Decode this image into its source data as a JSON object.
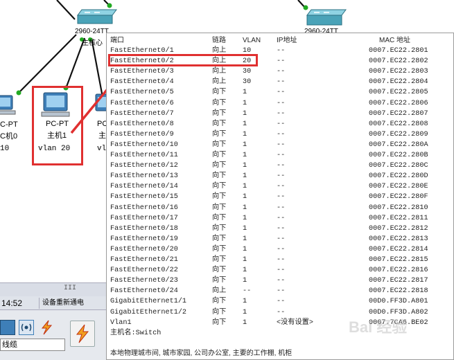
{
  "switch_labels": {
    "left_model": "2960-24TT",
    "left_name": "主核心",
    "right_model": "2960-24TT"
  },
  "pcs": [
    {
      "type": "PC-PT",
      "name": "C机0",
      "vlan": "10",
      "type_cut": "C-PT"
    },
    {
      "type": "PC-PT",
      "name": "主机1",
      "vlan": "vlan 20"
    },
    {
      "type": "PC",
      "name": "主",
      "vlan": "vl"
    }
  ],
  "popup": {
    "headers": {
      "port": "端口",
      "link": "链路",
      "vlan": "VLAN",
      "ip": "IP地址",
      "mac": "MAC 地址"
    },
    "rows": [
      {
        "port": "FastEthernet0/1",
        "link": "向上",
        "vlan": "10",
        "ip": "--",
        "mac": "0007.EC22.2801"
      },
      {
        "port": "FastEthernet0/2",
        "link": "向上",
        "vlan": "20",
        "ip": "--",
        "mac": "0007.EC22.2802"
      },
      {
        "port": "FastEthernet0/3",
        "link": "向上",
        "vlan": "30",
        "ip": "--",
        "mac": "0007.EC22.2803"
      },
      {
        "port": "FastEthernet0/4",
        "link": "向上",
        "vlan": "30",
        "ip": "--",
        "mac": "0007.EC22.2804"
      },
      {
        "port": "FastEthernet0/5",
        "link": "向下",
        "vlan": "1",
        "ip": "--",
        "mac": "0007.EC22.2805"
      },
      {
        "port": "FastEthernet0/6",
        "link": "向下",
        "vlan": "1",
        "ip": "--",
        "mac": "0007.EC22.2806"
      },
      {
        "port": "FastEthernet0/7",
        "link": "向下",
        "vlan": "1",
        "ip": "--",
        "mac": "0007.EC22.2807"
      },
      {
        "port": "FastEthernet0/8",
        "link": "向下",
        "vlan": "1",
        "ip": "--",
        "mac": "0007.EC22.2808"
      },
      {
        "port": "FastEthernet0/9",
        "link": "向下",
        "vlan": "1",
        "ip": "--",
        "mac": "0007.EC22.2809"
      },
      {
        "port": "FastEthernet0/10",
        "link": "向下",
        "vlan": "1",
        "ip": "--",
        "mac": "0007.EC22.280A"
      },
      {
        "port": "FastEthernet0/11",
        "link": "向下",
        "vlan": "1",
        "ip": "--",
        "mac": "0007.EC22.280B"
      },
      {
        "port": "FastEthernet0/12",
        "link": "向下",
        "vlan": "1",
        "ip": "--",
        "mac": "0007.EC22.280C"
      },
      {
        "port": "FastEthernet0/13",
        "link": "向下",
        "vlan": "1",
        "ip": "--",
        "mac": "0007.EC22.280D"
      },
      {
        "port": "FastEthernet0/14",
        "link": "向下",
        "vlan": "1",
        "ip": "--",
        "mac": "0007.EC22.280E"
      },
      {
        "port": "FastEthernet0/15",
        "link": "向下",
        "vlan": "1",
        "ip": "--",
        "mac": "0007.EC22.280F"
      },
      {
        "port": "FastEthernet0/16",
        "link": "向下",
        "vlan": "1",
        "ip": "--",
        "mac": "0007.EC22.2810"
      },
      {
        "port": "FastEthernet0/17",
        "link": "向下",
        "vlan": "1",
        "ip": "--",
        "mac": "0007.EC22.2811"
      },
      {
        "port": "FastEthernet0/18",
        "link": "向下",
        "vlan": "1",
        "ip": "--",
        "mac": "0007.EC22.2812"
      },
      {
        "port": "FastEthernet0/19",
        "link": "向下",
        "vlan": "1",
        "ip": "--",
        "mac": "0007.EC22.2813"
      },
      {
        "port": "FastEthernet0/20",
        "link": "向下",
        "vlan": "1",
        "ip": "--",
        "mac": "0007.EC22.2814"
      },
      {
        "port": "FastEthernet0/21",
        "link": "向下",
        "vlan": "1",
        "ip": "--",
        "mac": "0007.EC22.2815"
      },
      {
        "port": "FastEthernet0/22",
        "link": "向下",
        "vlan": "1",
        "ip": "--",
        "mac": "0007.EC22.2816"
      },
      {
        "port": "FastEthernet0/23",
        "link": "向下",
        "vlan": "1",
        "ip": "--",
        "mac": "0007.EC22.2817"
      },
      {
        "port": "FastEthernet0/24",
        "link": "向上",
        "vlan": "--",
        "ip": "--",
        "mac": "0007.EC22.2818"
      },
      {
        "port": "GigabitEthernet1/1",
        "link": "向下",
        "vlan": "1",
        "ip": "--",
        "mac": "00D0.FF3D.A801"
      },
      {
        "port": "GigabitEthernet1/2",
        "link": "向下",
        "vlan": "1",
        "ip": "--",
        "mac": "00D0.FF3D.A802"
      },
      {
        "port": "Vlan1",
        "link": "向下",
        "vlan": "1",
        "ip": "<没有设置>",
        "mac": "0007.7CA6.BE02"
      }
    ],
    "hostname": "主机名:Switch",
    "location": "本地物理城市间, 城市家园, 公司办公室, 主要的工作棚, 机柜"
  },
  "bottom_ui": {
    "grip": "III",
    "time": "14:52",
    "status": "设备重新通电",
    "cable_field": "线缆"
  },
  "watermark": "Bai 经验",
  "colors": {
    "annotation_red": "#e03030",
    "link_green": "#22aa22",
    "switch_teal": "#4aa3b8"
  }
}
